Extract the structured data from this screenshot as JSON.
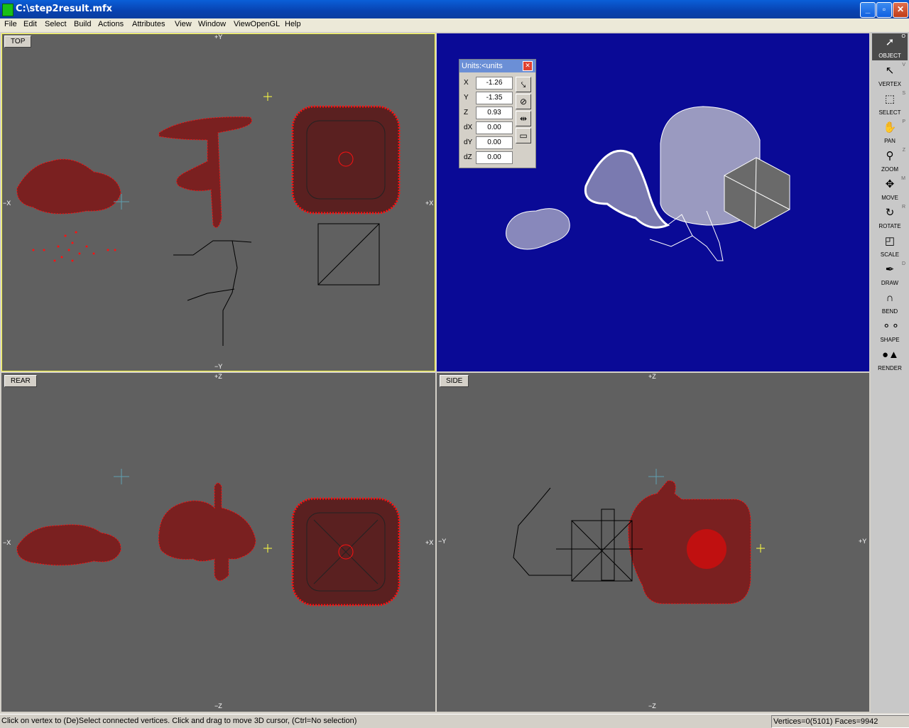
{
  "window": {
    "title": "C:\\step2result.mfx"
  },
  "menu": [
    "File",
    "Edit",
    "Select",
    "Build",
    "Actions",
    "Attributes",
    "View",
    "Window",
    "ViewOpenGL",
    "Help"
  ],
  "viewports": {
    "top": {
      "label": "TOP",
      "axis_top": "+Y",
      "axis_bottom": "−Y",
      "axis_left": "−X",
      "axis_right": "+X"
    },
    "rear": {
      "label": "REAR",
      "axis_top": "+Z",
      "axis_bottom": "−Z",
      "axis_left": "−X",
      "axis_right": "+X"
    },
    "side": {
      "label": "SIDE",
      "axis_top": "+Z",
      "axis_bottom": "−Z",
      "axis_left": "−Y",
      "axis_right": "+Y"
    }
  },
  "units_panel": {
    "title": "Units:<units",
    "rows": [
      {
        "label": "X",
        "value": "-1.26"
      },
      {
        "label": "Y",
        "value": "-1.35"
      },
      {
        "label": "Z",
        "value": "0.93"
      },
      {
        "label": "dX",
        "value": "0.00"
      },
      {
        "label": "dY",
        "value": "0.00"
      },
      {
        "label": "dZ",
        "value": "0.00"
      }
    ]
  },
  "tools": [
    {
      "label": "OBJECT",
      "key": "O",
      "icon": "arrow-cursor-icon"
    },
    {
      "label": "VERTEX",
      "key": "V",
      "icon": "vertex-arrow-icon"
    },
    {
      "label": "SELECT",
      "key": "S",
      "icon": "marquee-icon"
    },
    {
      "label": "PAN",
      "key": "P",
      "icon": "hand-icon"
    },
    {
      "label": "ZOOM",
      "key": "Z",
      "icon": "magnifier-icon"
    },
    {
      "label": "MOVE",
      "key": "M",
      "icon": "move-arrows-icon"
    },
    {
      "label": "ROTATE",
      "key": "R",
      "icon": "rotate-icon"
    },
    {
      "label": "SCALE",
      "key": "",
      "icon": "scale-icon"
    },
    {
      "label": "DRAW",
      "key": "D",
      "icon": "pen-icon"
    },
    {
      "label": "BEND",
      "key": "",
      "icon": "magnet-icon"
    },
    {
      "label": "SHAPE",
      "key": "",
      "icon": "spheres-icon"
    },
    {
      "label": "RENDER",
      "key": "",
      "icon": "render-icon"
    }
  ],
  "status": {
    "message": "Click on vertex to (De)Select connected vertices. Click and drag to move 3D cursor, (Ctrl=No selection)",
    "counts": "Vertices=0(5101) Faces=9942"
  },
  "colors": {
    "viewport": "#606060",
    "perspective": "#0a0a96",
    "selection": "#ff1010",
    "cursor": "#ffff40"
  }
}
